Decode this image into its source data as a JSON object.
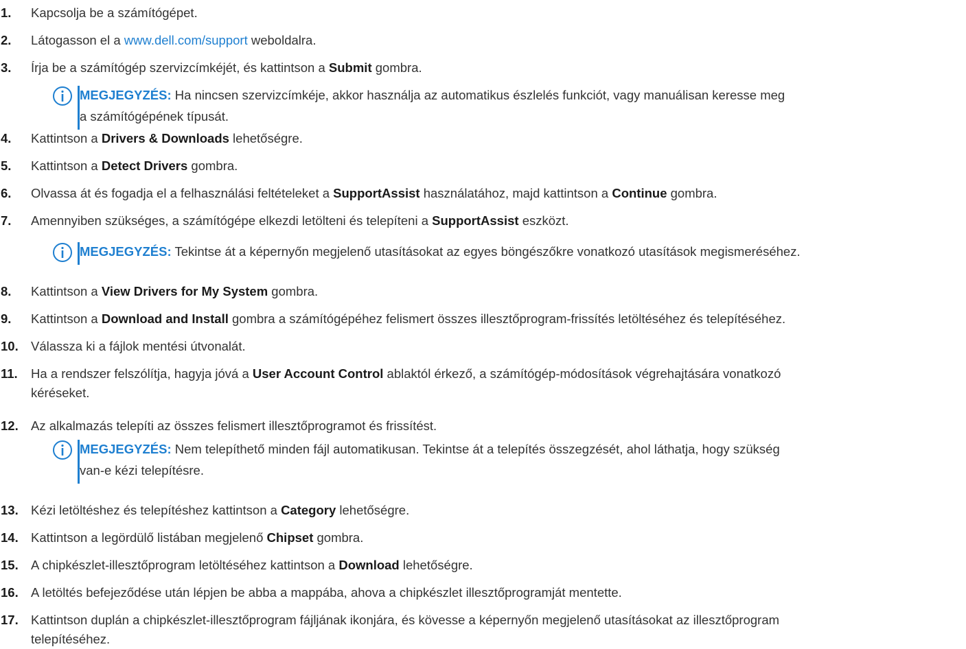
{
  "steps": [
    {
      "number": "1.",
      "parts": [
        {
          "t": "Kapcsolja be a számítógépet."
        }
      ]
    },
    {
      "number": "2.",
      "parts": [
        {
          "t": "Látogasson el a "
        },
        {
          "t": "www.dell.com/support",
          "link": true
        },
        {
          "t": " weboldalra."
        }
      ]
    },
    {
      "number": "3.",
      "parts": [
        {
          "t": "Írja be a számítógép szervizcímkéjét, és kattintson a "
        },
        {
          "t": "Submit",
          "b": true
        },
        {
          "t": " gombra."
        }
      ]
    },
    {
      "number": "4.",
      "parts": [
        {
          "t": "Kattintson a "
        },
        {
          "t": "Drivers & Downloads",
          "b": true
        },
        {
          "t": " lehetőségre."
        }
      ]
    },
    {
      "number": "5.",
      "parts": [
        {
          "t": "Kattintson a "
        },
        {
          "t": "Detect Drivers",
          "b": true
        },
        {
          "t": " gombra."
        }
      ]
    },
    {
      "number": "6.",
      "parts": [
        {
          "t": "Olvassa át és fogadja el a felhasználási feltételeket a "
        },
        {
          "t": "SupportAssist",
          "b": true
        },
        {
          "t": " használatához, majd kattintson a "
        },
        {
          "t": "Continue",
          "b": true
        },
        {
          "t": " gombra."
        }
      ]
    },
    {
      "number": "7.",
      "parts": [
        {
          "t": "Amennyiben szükséges, a számítógépe elkezdi letölteni és telepíteni a "
        },
        {
          "t": "SupportAssist",
          "b": true
        },
        {
          "t": " eszközt."
        }
      ]
    },
    {
      "number": "8.",
      "parts": [
        {
          "t": "Kattintson a "
        },
        {
          "t": "View Drivers for My System",
          "b": true
        },
        {
          "t": " gombra."
        }
      ]
    },
    {
      "number": "9.",
      "parts": [
        {
          "t": "Kattintson a "
        },
        {
          "t": "Download and Install",
          "b": true
        },
        {
          "t": " gombra a számítógépéhez felismert összes illesztőprogram-frissítés letöltéséhez és telepítéséhez."
        }
      ]
    },
    {
      "number": "10.",
      "parts": [
        {
          "t": "Válassza ki a fájlok mentési útvonalát."
        }
      ]
    },
    {
      "number": "11.",
      "parts": [
        {
          "t": "Ha a rendszer felszólítja, hagyja jóvá a "
        },
        {
          "t": "User Account Control",
          "b": true
        },
        {
          "t": " ablaktól érkező, a számítógép-módosítások végrehajtására vonatkozó"
        }
      ],
      "cont": "kéréseket."
    },
    {
      "number": "12.",
      "parts": [
        {
          "t": "Az alkalmazás telepíti az összes felismert illesztőprogramot és frissítést."
        }
      ]
    },
    {
      "number": "13.",
      "parts": [
        {
          "t": "Kézi letöltéshez és telepítéshez kattintson a "
        },
        {
          "t": "Category",
          "b": true
        },
        {
          "t": " lehetőségre."
        }
      ]
    },
    {
      "number": "14.",
      "parts": [
        {
          "t": "Kattintson a legördülő listában megjelenő "
        },
        {
          "t": "Chipset",
          "b": true
        },
        {
          "t": " gombra."
        }
      ]
    },
    {
      "number": "15.",
      "parts": [
        {
          "t": "A chipkészlet-illesztőprogram letöltéséhez kattintson a "
        },
        {
          "t": "Download",
          "b": true
        },
        {
          "t": " lehetőségre."
        }
      ]
    },
    {
      "number": "16.",
      "parts": [
        {
          "t": "A letöltés befejeződése után lépjen be abba a mappába, ahova a chipkészlet illesztőprogramját mentette."
        }
      ]
    },
    {
      "number": "17.",
      "parts": [
        {
          "t": "Kattintson duplán a chipkészlet-illesztőprogram fájljának ikonjára, és kövesse a képernyőn megjelenő utasításokat az illesztőprogram"
        }
      ],
      "cont": "telepítéséhez."
    }
  ],
  "notes": [
    {
      "after_step": "3.",
      "label": "MEGJEGYZÉS:",
      "lines": [
        "Ha nincsen szervizcímkéje, akkor használja az automatikus észlelés funkciót, vagy manuálisan keresse meg",
        "a számítógépének típusát."
      ]
    },
    {
      "after_step": "7.",
      "label": "MEGJEGYZÉS:",
      "lines": [
        "Tekintse át a képernyőn megjelenő utasításokat az egyes böngészőkre vonatkozó utasítások megismeréséhez."
      ]
    },
    {
      "after_step": "12.",
      "label": "MEGJEGYZÉS:",
      "lines": [
        "Nem telepíthető minden fájl automatikusan. Tekintse át a telepítés összegzését, ahol láthatja, hogy szükség",
        "van-e kézi telepítésre."
      ]
    }
  ],
  "icon": "info-icon",
  "colors": {
    "accent": "#1e7fd0",
    "text": "#333333"
  }
}
